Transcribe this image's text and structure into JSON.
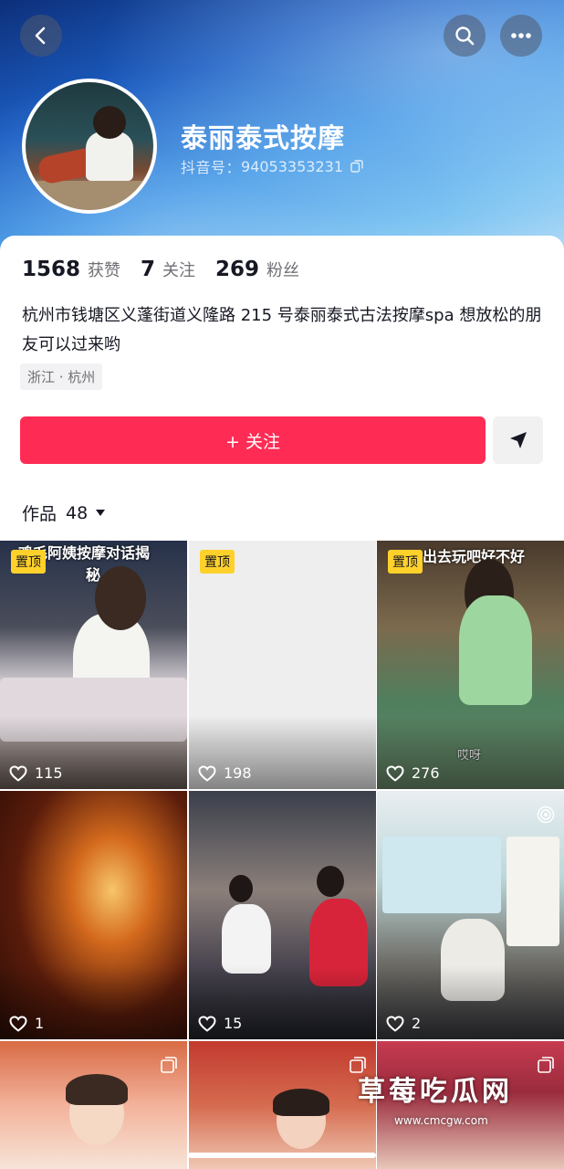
{
  "header": {
    "back_icon": "chevron-left-icon",
    "search_icon": "search-icon",
    "more_icon": "more-dots-icon"
  },
  "profile": {
    "name": "泰丽泰式按摩",
    "uid_label": "抖音号：",
    "uid": "94053353231",
    "copy_icon": "copy-icon"
  },
  "stats": [
    {
      "value": "1568",
      "label": "获赞"
    },
    {
      "value": "7",
      "label": "关注"
    },
    {
      "value": "269",
      "label": "粉丝"
    }
  ],
  "bio": {
    "text": "杭州市钱塘区义蓬街道义隆路 215 号泰丽泰式古法按摩spa  想放松的朋友可以过来哟",
    "location": "浙江 · 杭州"
  },
  "actions": {
    "follow_label": "+ 关注",
    "share_icon": "send-icon"
  },
  "works": {
    "label": "作品",
    "count": "48"
  },
  "videos": [
    {
      "pinned": "置顶",
      "likes": "115",
      "title": "鸡毛阿姨按摩对话揭",
      "sub": "秘"
    },
    {
      "pinned": "置顶",
      "likes": "198"
    },
    {
      "pinned": "置顶",
      "likes": "276",
      "title": "出去玩吧好不好",
      "caption": "哎呀"
    },
    {
      "likes": "1"
    },
    {
      "likes": "15"
    },
    {
      "likes": "2"
    },
    {},
    {},
    {}
  ],
  "watermark": {
    "main": "草莓吃瓜网",
    "url": "www.cmcgw.com"
  }
}
